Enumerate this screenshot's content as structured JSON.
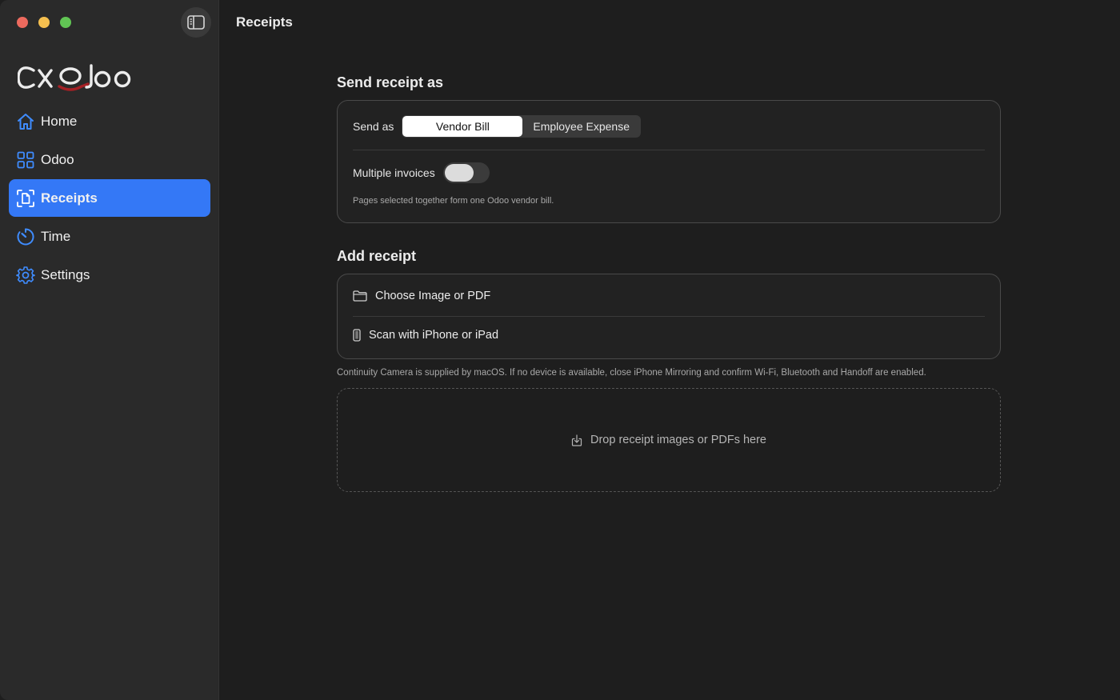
{
  "window": {
    "title": "Receipts"
  },
  "sidebar": {
    "items": [
      {
        "label": "Home",
        "icon": "home-icon"
      },
      {
        "label": "Odoo",
        "icon": "grid-icon"
      },
      {
        "label": "Receipts",
        "icon": "receipt-scan-icon",
        "active": true
      },
      {
        "label": "Time",
        "icon": "timer-icon"
      },
      {
        "label": "Settings",
        "icon": "gear-icon"
      }
    ]
  },
  "send_section": {
    "heading": "Send receipt as",
    "send_as_label": "Send as",
    "options": [
      "Vendor Bill",
      "Employee Expense"
    ],
    "selected": "Vendor Bill",
    "multiple_label": "Multiple invoices",
    "multiple_on": false,
    "note": "Pages selected together form one Odoo vendor bill."
  },
  "add_section": {
    "heading": "Add receipt",
    "choose_label": "Choose Image or PDF",
    "scan_label": "Scan with iPhone or iPad",
    "continuity_note": "Continuity Camera is supplied by macOS. If no device is available, close iPhone Mirroring and confirm Wi-Fi, Bluetooth and Handoff are enabled.",
    "drop_label": "Drop receipt images or PDFs here"
  },
  "colors": {
    "accent": "#3478f6",
    "icon_blue": "#3f8cff",
    "logo_red": "#a52025"
  }
}
